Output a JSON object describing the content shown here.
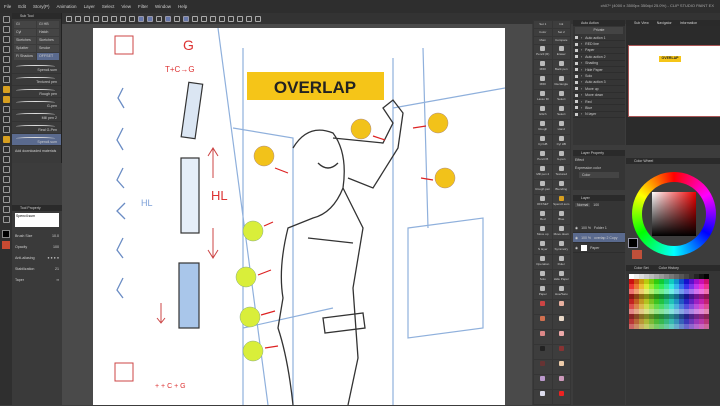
{
  "window": {
    "title": "ch07* (4000 x 3500px 350dpi 25.0%) - CLIP STUDIO PAINT EX"
  },
  "menu": [
    "File",
    "Edit",
    "Story(P)",
    "Animation",
    "Layer",
    "Select",
    "View",
    "Filter",
    "Window",
    "Help"
  ],
  "subtool": {
    "tab": "Sub Tool",
    "items": [
      "Gl",
      "Gl HB",
      "Cyl",
      "Hatch",
      "Sketches",
      "Sketches",
      "Splatter",
      "Smoke",
      "Fi Shadow",
      "OFFSET"
    ],
    "brushes": [
      "Spencil.sum",
      "Textured pen",
      "Rough pen",
      "G-pen",
      "Mill pen 2",
      "Real G-Pen",
      "Spencil.sum"
    ],
    "add_material": "Add downloaded materials"
  },
  "toolprop": {
    "tab": "Tool Property",
    "brush_name": "Spencil.sum",
    "brush_size_label": "Brush Size",
    "brush_size": "10.0",
    "opacity_label": "Opacity",
    "opacity": "100",
    "aa_label": "Anti-aliasing",
    "stab_label": "Stabilization",
    "stabilization": "21",
    "taper_label": "Taper"
  },
  "canvas": {
    "banner": "OVERLAP",
    "g": "G",
    "formula": "T+C→G",
    "hl1": "HL",
    "hl2": "HL",
    "formula2": "+ + C + G"
  },
  "command": {
    "tabs": [
      "Set 1",
      "Ink",
      "Color",
      "Set 2",
      "Main",
      "Compare"
    ],
    "items": [
      "Pencil (R)",
      "Eraser",
      "MIDI",
      "Back pen",
      "MIDI",
      "Rectangle",
      "Lasso fill",
      "Select",
      "Glitch",
      "Select",
      "Rough",
      "Hand",
      "Cyl HB",
      "Cyl HB",
      "Pencil B",
      "G-pen",
      "Mill pen 2",
      "Textured",
      "Rough pen",
      "Blending",
      "OFFSET",
      "Spencil.sum",
      "Red",
      "Blue",
      "Move up",
      "Move down",
      "N layer",
      "Symmetry",
      "Operation",
      "Ruler",
      "Solo",
      "Hide Paper",
      "Paper",
      "Hue/Satu"
    ]
  },
  "autoaction": {
    "tab": "Auto Action",
    "set": "Private",
    "items": [
      "Auto action 1",
      "RED line",
      "Paper",
      "Auto action 2",
      "Shading",
      "Hide Paper",
      "Solo",
      "Auto action 3",
      "Move up",
      "Move down",
      "Red",
      "Blue",
      "N layer"
    ]
  },
  "navigator": {
    "tabs": [
      "Sub View",
      "Navigator",
      "Information"
    ]
  },
  "layerprop": {
    "tab": "Layer Property",
    "effect": "Effect",
    "expr": "Expression color",
    "color": "Color"
  },
  "layers": {
    "tab": "Layer",
    "blend": "Normal",
    "opacity": "100",
    "items": [
      {
        "pct": "100 %",
        "name": "Folder 1"
      },
      {
        "pct": "100 %",
        "name": "overlap 2 Copy"
      },
      {
        "pct": "",
        "name": "Paper"
      }
    ]
  },
  "colorwheel": {
    "tab": "Color Wheel",
    "main": "#000000",
    "sub": "#c0503a"
  },
  "colorset": {
    "tabs": [
      "Color Set",
      "Color History"
    ]
  }
}
